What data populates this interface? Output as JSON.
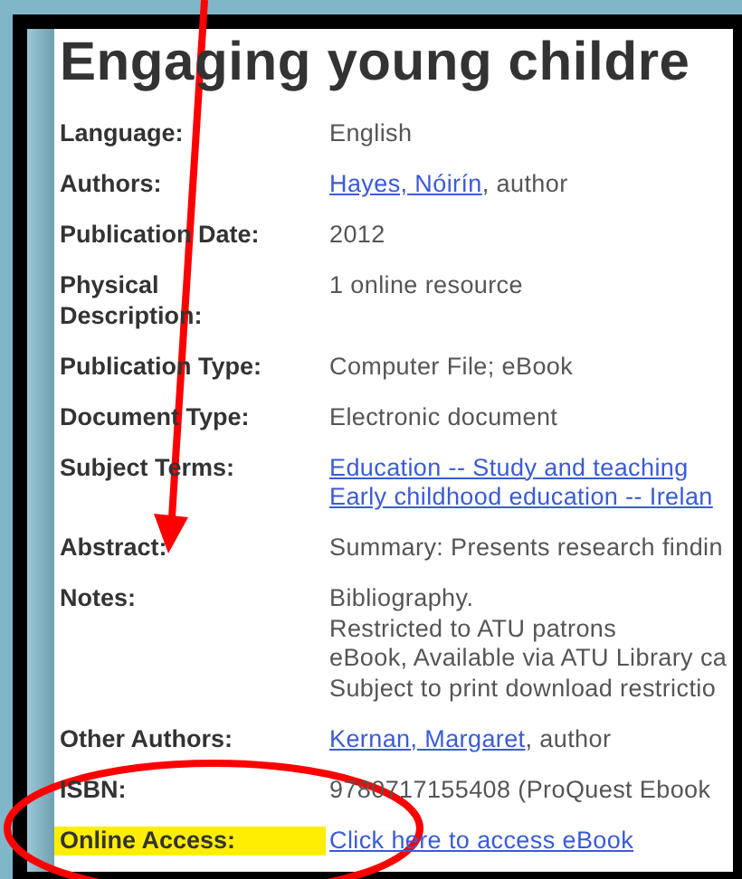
{
  "title": "Engaging young childre",
  "rows": [
    {
      "label": "Language:",
      "highlighted": false,
      "lines": [
        [
          {
            "kind": "text",
            "text": "English"
          }
        ]
      ]
    },
    {
      "label": "Authors:",
      "highlighted": false,
      "lines": [
        [
          {
            "kind": "link",
            "text": "Hayes, Nóirín"
          },
          {
            "kind": "text",
            "text": ", author"
          }
        ]
      ]
    },
    {
      "label": "Publication Date:",
      "highlighted": false,
      "lines": [
        [
          {
            "kind": "text",
            "text": "2012"
          }
        ]
      ]
    },
    {
      "label": "Physical Description:",
      "highlighted": false,
      "lines": [
        [
          {
            "kind": "text",
            "text": "1 online resource"
          }
        ]
      ]
    },
    {
      "label": "Publication Type:",
      "highlighted": false,
      "lines": [
        [
          {
            "kind": "text",
            "text": "Computer File; eBook"
          }
        ]
      ]
    },
    {
      "label": "Document Type:",
      "highlighted": false,
      "lines": [
        [
          {
            "kind": "text",
            "text": "Electronic document"
          }
        ]
      ]
    },
    {
      "label": "Subject Terms:",
      "highlighted": false,
      "lines": [
        [
          {
            "kind": "link",
            "text": "Education -- Study and teaching"
          }
        ],
        [
          {
            "kind": "link",
            "text": "Early childhood education -- Irelan"
          }
        ]
      ]
    },
    {
      "label": "Abstract:",
      "highlighted": false,
      "lines": [
        [
          {
            "kind": "text",
            "text": "Summary: Presents research findin"
          }
        ]
      ]
    },
    {
      "label": "Notes:",
      "highlighted": false,
      "lines": [
        [
          {
            "kind": "text",
            "text": "Bibliography."
          }
        ],
        [
          {
            "kind": "text",
            "text": "Restricted to ATU patrons"
          }
        ],
        [
          {
            "kind": "text",
            "text": "eBook, Available via ATU Library ca"
          }
        ],
        [
          {
            "kind": "text",
            "text": "Subject to print download restrictio"
          }
        ]
      ]
    },
    {
      "label": "Other Authors:",
      "highlighted": false,
      "lines": [
        [
          {
            "kind": "link",
            "text": "Kernan, Margaret"
          },
          {
            "kind": "text",
            "text": ", author"
          }
        ]
      ]
    },
    {
      "label": "ISBN:",
      "highlighted": false,
      "lines": [
        [
          {
            "kind": "text",
            "text": "9780717155408 (ProQuest Ebook"
          }
        ]
      ]
    },
    {
      "label": "Online Access:",
      "highlighted": true,
      "lines": [
        [
          {
            "kind": "link",
            "text": "Click here to access eBook"
          }
        ]
      ]
    }
  ]
}
